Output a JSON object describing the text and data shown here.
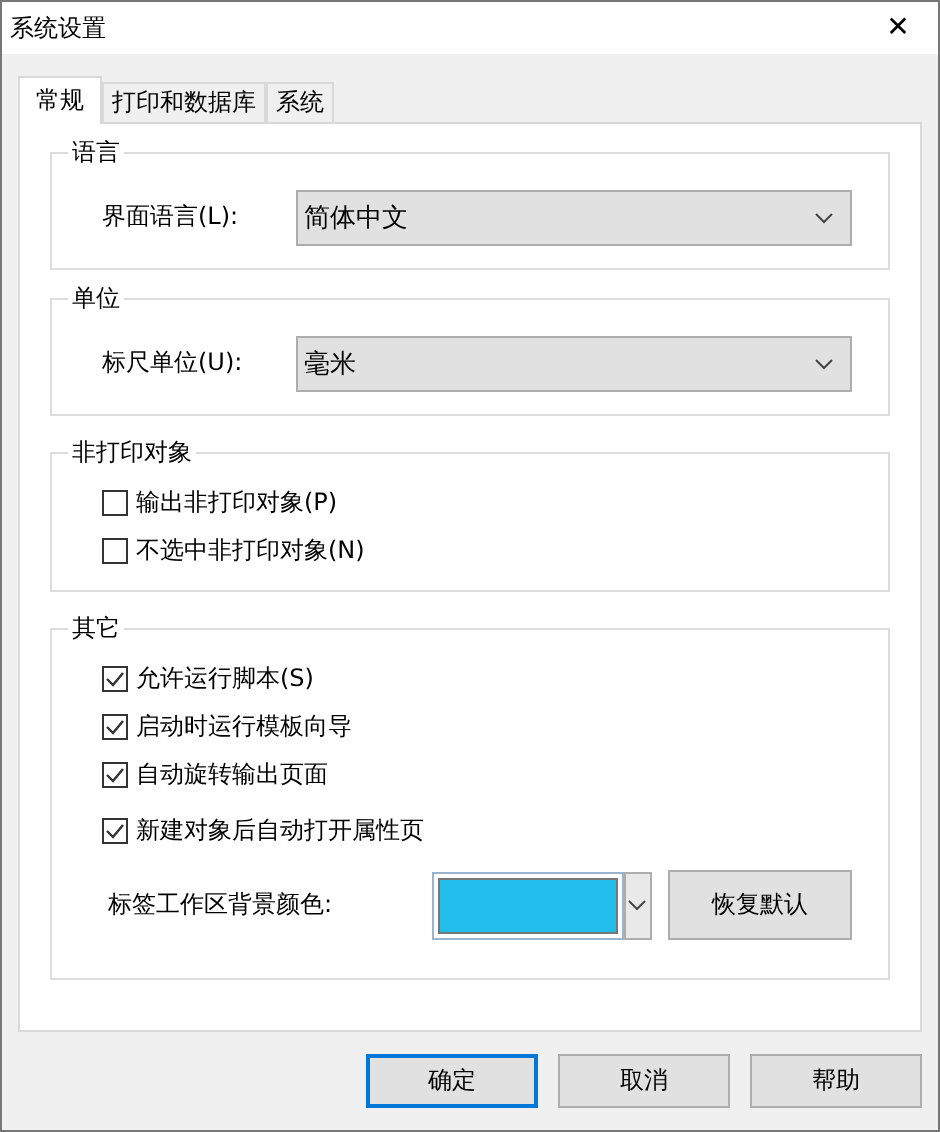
{
  "window": {
    "title": "系统设置",
    "close": "✕"
  },
  "tabs": [
    {
      "label": "常规",
      "selected": true
    },
    {
      "label": "打印和数据库",
      "selected": false
    },
    {
      "label": "系统",
      "selected": false
    }
  ],
  "language": {
    "title": "语言",
    "label": "界面语言(L):",
    "value": "简体中文"
  },
  "unit": {
    "title": "单位",
    "label": "标尺单位(U):",
    "value": "毫米"
  },
  "non_print": {
    "title": "非打印对象",
    "options": [
      {
        "label": "输出非打印对象(P)",
        "checked": false
      },
      {
        "label": "不选中非打印对象(N)",
        "checked": false
      }
    ]
  },
  "other": {
    "title": "其它",
    "options": [
      {
        "label": "允许运行脚本(S)",
        "checked": true
      },
      {
        "label": "启动时运行模板向导",
        "checked": true
      },
      {
        "label": "自动旋转输出页面",
        "checked": true
      },
      {
        "label": "新建对象后自动打开属性页",
        "checked": true
      }
    ],
    "color_label": "标签工作区背景颜色:",
    "color": "#22bdeb",
    "reset_button": "恢复默认"
  },
  "buttons": [
    {
      "label": "确定",
      "selected": true
    },
    {
      "label": "取消",
      "selected": false
    },
    {
      "label": "帮助",
      "selected": false
    }
  ]
}
